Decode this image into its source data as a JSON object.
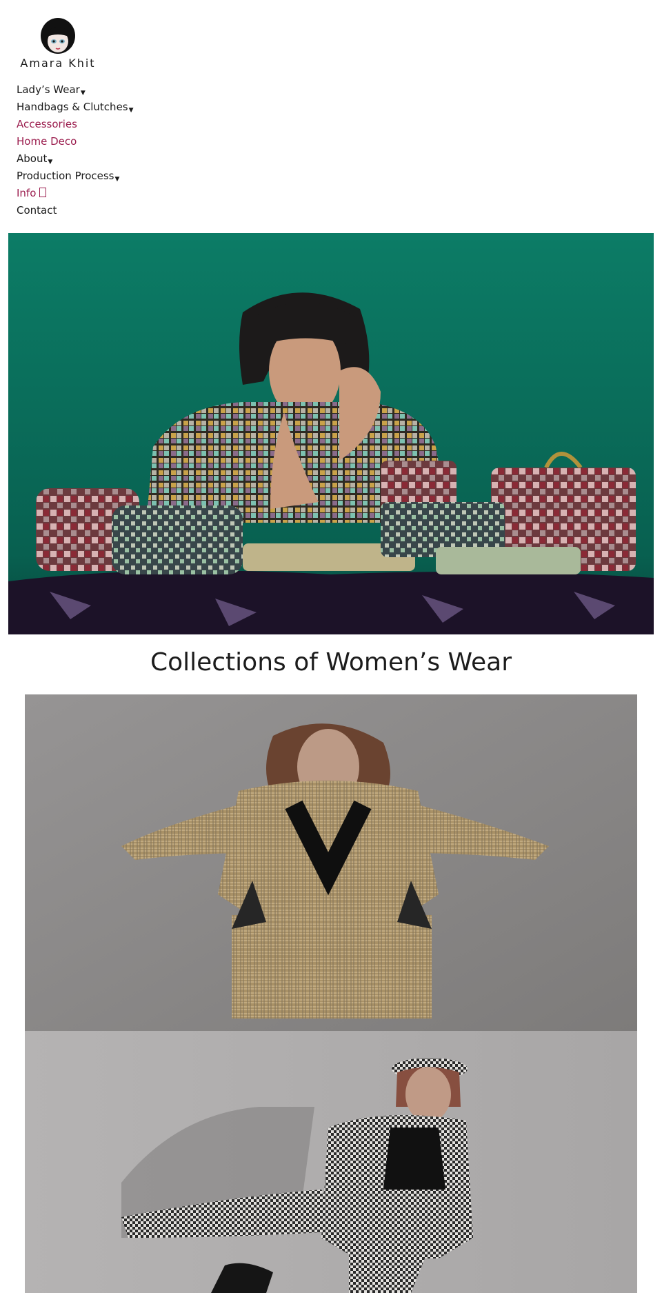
{
  "brand": {
    "name": "Amara Khit",
    "logo_icon": "girl-face-logo"
  },
  "nav": {
    "items": [
      {
        "label": "Lady’s Wear",
        "has_dropdown": true,
        "caret": "▼"
      },
      {
        "label": "Handbags & Clutches",
        "has_dropdown": true,
        "caret": "▼"
      },
      {
        "label": "Accessories",
        "has_dropdown": false
      },
      {
        "label": "Home Deco",
        "has_dropdown": false
      },
      {
        "label": "About",
        "has_dropdown": true,
        "caret": "▼"
      },
      {
        "label": "Production Process",
        "has_dropdown": true,
        "caret": "▼"
      },
      {
        "label": "Info",
        "has_dropdown": false
      },
      {
        "label": "Contact",
        "has_dropdown": false
      }
    ],
    "accent_color": "#9b1d4e",
    "text_color": "#1a1a1a"
  },
  "hero": {
    "image": "hero-banner-image",
    "background_color": "#0b7a66"
  },
  "collections": {
    "title": "Collections of Women’s Wear",
    "photos": [
      {
        "image": "collection-photo-tweed-suit"
      },
      {
        "image": "collection-photo-houndstooth-suit"
      }
    ]
  }
}
